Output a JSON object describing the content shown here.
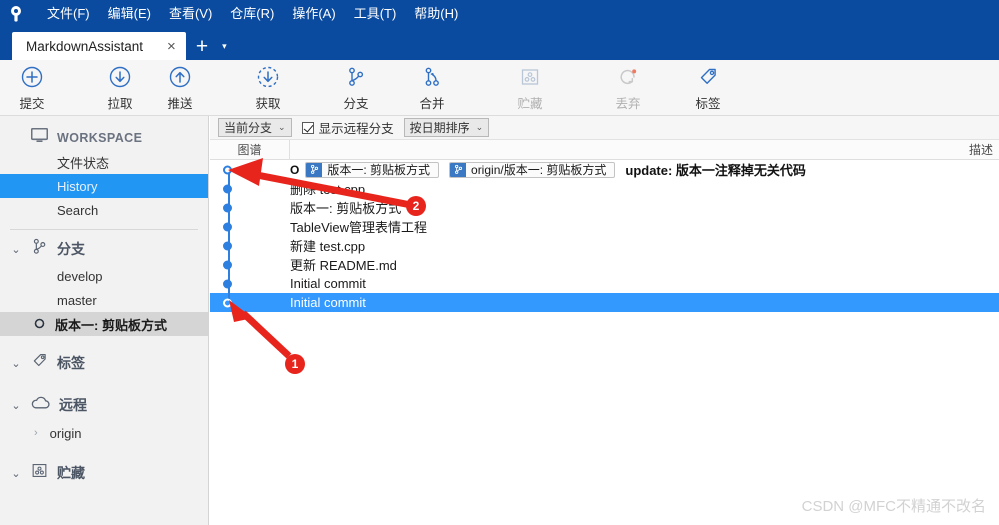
{
  "window": {
    "logo_icon": "sourcetree-logo-icon",
    "menu": [
      {
        "label": "文件(F)",
        "mnemonic": "F"
      },
      {
        "label": "编辑(E)",
        "mnemonic": "E"
      },
      {
        "label": "查看(V)",
        "mnemonic": "V"
      },
      {
        "label": "仓库(R)",
        "mnemonic": "R"
      },
      {
        "label": "操作(A)",
        "mnemonic": "A"
      },
      {
        "label": "工具(T)",
        "mnemonic": "T"
      },
      {
        "label": "帮助(H)",
        "mnemonic": "H"
      }
    ]
  },
  "tabs": {
    "active": "MarkdownAssistant",
    "close_label": "×",
    "add_label": "+",
    "caret_label": "▾"
  },
  "toolbar": {
    "buttons": [
      {
        "label": "提交",
        "icon": "commit-plus-icon",
        "disabled": false
      },
      {
        "label": "拉取",
        "icon": "pull-down-icon",
        "disabled": false
      },
      {
        "label": "推送",
        "icon": "push-up-icon",
        "disabled": false
      },
      {
        "label": "获取",
        "icon": "fetch-dashed-icon",
        "disabled": false
      },
      {
        "label": "分支",
        "icon": "branch-icon",
        "disabled": false
      },
      {
        "label": "合并",
        "icon": "merge-icon",
        "disabled": false
      },
      {
        "label": "贮藏",
        "icon": "stash-icon",
        "disabled": true
      },
      {
        "label": "丢弃",
        "icon": "discard-icon",
        "disabled": true
      },
      {
        "label": "标签",
        "icon": "tag-icon",
        "disabled": false
      }
    ]
  },
  "sidebar": {
    "workspace": {
      "label": "WORKSPACE",
      "icon": "monitor-icon"
    },
    "workspace_items": [
      {
        "label": "文件状态",
        "selected": false
      },
      {
        "label": "History",
        "selected": true
      },
      {
        "label": "Search",
        "selected": false
      }
    ],
    "groups": [
      {
        "label": "分支",
        "icon": "branch-icon",
        "expanded": true,
        "chevron": "⌄",
        "items": [
          {
            "label": "develop",
            "current": false
          },
          {
            "label": "master",
            "current": false
          },
          {
            "label": "版本一: 剪贴板方式",
            "current": true,
            "icon": "current-branch-dot-icon"
          }
        ]
      },
      {
        "label": "标签",
        "icon": "tag-icon",
        "expanded": true,
        "chevron": "⌄",
        "items": []
      },
      {
        "label": "远程",
        "icon": "cloud-icon",
        "expanded": true,
        "chevron": "⌄",
        "items": [
          {
            "label": "origin",
            "current": false,
            "chevron": "›"
          }
        ]
      },
      {
        "label": "贮藏",
        "icon": "stash-icon",
        "expanded": true,
        "chevron": "⌄",
        "items": []
      }
    ]
  },
  "filterbar": {
    "branch_filter": {
      "label": "当前分支",
      "caret": "⌄"
    },
    "remote_checkbox": {
      "label": "显示远程分支",
      "checked": true
    },
    "sort": {
      "label": "按日期排序",
      "caret": "⌄"
    }
  },
  "columns": {
    "graph": "图谱",
    "description": "描述"
  },
  "commits": [
    {
      "graph": "hollow",
      "head_mark": "O",
      "refs": [
        {
          "text": "版本一: 剪贴板方式",
          "icon": "branch-ref-icon"
        },
        {
          "text": "origin/版本一: 剪贴板方式",
          "icon": "branch-ref-icon"
        }
      ],
      "message": "update: 版本一注释掉无关代码",
      "bold": true,
      "selected": false
    },
    {
      "graph": "dot",
      "refs": [],
      "message": "删除 test.cpp",
      "bold": false,
      "selected": false
    },
    {
      "graph": "dot",
      "refs": [],
      "message": "版本一: 剪贴板方式",
      "bold": false,
      "selected": false
    },
    {
      "graph": "dot",
      "refs": [],
      "message": "TableView管理表情工程",
      "bold": false,
      "selected": false
    },
    {
      "graph": "dot",
      "refs": [],
      "message": "新建 test.cpp",
      "bold": false,
      "selected": false
    },
    {
      "graph": "dot",
      "refs": [],
      "message": "更新 README.md",
      "bold": false,
      "selected": false
    },
    {
      "graph": "dot",
      "refs": [],
      "message": "Initial commit",
      "bold": false,
      "selected": false
    },
    {
      "graph": "hollow-sel",
      "refs": [],
      "message": "Initial commit",
      "bold": false,
      "selected": true
    }
  ],
  "annotations": {
    "arrows": [
      {
        "name": "arrow-to-head-commit-dot",
        "badge": "2"
      },
      {
        "name": "arrow-to-initial-commit-dot",
        "badge": "1"
      }
    ],
    "badge_1": "1",
    "badge_2": "2",
    "color": "#e8251c"
  },
  "watermark": "CSDN @MFC不精通不改名",
  "colors": {
    "titlebar": "#0a4ba0",
    "accent": "#2196f3",
    "selection": "#3399ff",
    "graph": "#2d7fe0",
    "annotation": "#e8251c"
  }
}
